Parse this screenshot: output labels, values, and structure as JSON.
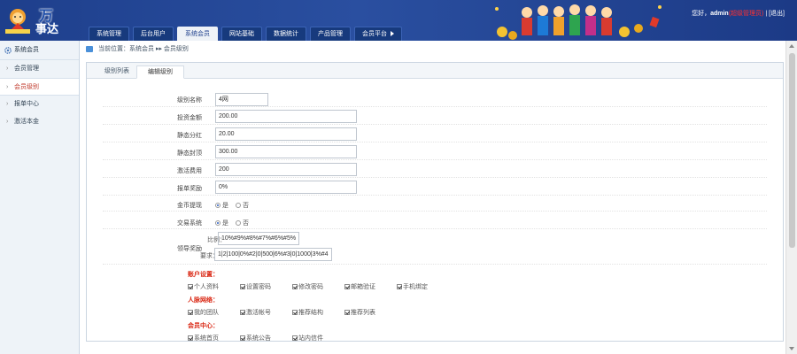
{
  "brand": {
    "wan": "万",
    "name": "事达"
  },
  "nav": {
    "tabs": [
      {
        "label": "系统管理"
      },
      {
        "label": "后台用户"
      },
      {
        "label": "系统会员"
      },
      {
        "label": "网站基础"
      },
      {
        "label": "数据统计"
      },
      {
        "label": "产品管理"
      },
      {
        "label": "会员平台"
      }
    ],
    "active_index": 2
  },
  "header": {
    "greeting": "您好，",
    "user": "admin",
    "role": "(超级管理员)",
    "sep": " | ",
    "logout": "[退出]"
  },
  "sidebar": {
    "title": "系统会员",
    "items": [
      {
        "label": "会员管理"
      },
      {
        "label": "会员级别"
      },
      {
        "label": "报单中心"
      },
      {
        "label": "激活本金"
      }
    ],
    "active_index": 1
  },
  "breadcrumb": {
    "prefix": "当前位置：",
    "path": "系统会员 ▸▸ 会员级别"
  },
  "panel_tabs": [
    "级别列表",
    "编辑级别"
  ],
  "form": {
    "fields": [
      {
        "label": "级别名称",
        "value": "4网"
      },
      {
        "label": "投资金额",
        "value": "200.00"
      },
      {
        "label": "静态分红",
        "value": "20.00"
      },
      {
        "label": "静态封顶",
        "value": "300.00"
      },
      {
        "label": "激活费用",
        "value": "200"
      },
      {
        "label": "报单奖励",
        "value": "0%"
      }
    ],
    "gold": {
      "label": "金币提现",
      "options": [
        "是",
        "否"
      ],
      "selected": 0
    },
    "trade": {
      "label": "交易系统",
      "options": [
        "是",
        "否"
      ],
      "selected": 0
    },
    "leader": {
      "label": "领导奖励",
      "ratio_label": "比例：",
      "ratio": "10%#9%#8%#7%#6%#5%",
      "req_label": "要求：",
      "req": "1|2|100|0%#2|0|500|6%#3|0|1000|3%#4"
    },
    "sections": [
      {
        "title": "账户设置：",
        "items": [
          "个人资料",
          "设置密码",
          "修改密码",
          "邮箱验证",
          "手机绑定"
        ]
      },
      {
        "title": "人脉网络：",
        "items": [
          "我的团队",
          "激活帐号",
          "推荐结构",
          "推荐列表"
        ]
      },
      {
        "title": "会员中心：",
        "items": [
          "系统首页",
          "系统公告",
          "站内信件"
        ]
      }
    ]
  },
  "colors": {
    "header_bg": "#1e3f8c",
    "accent_red": "#d9230f",
    "sidebar_bg": "#eef3f8"
  }
}
